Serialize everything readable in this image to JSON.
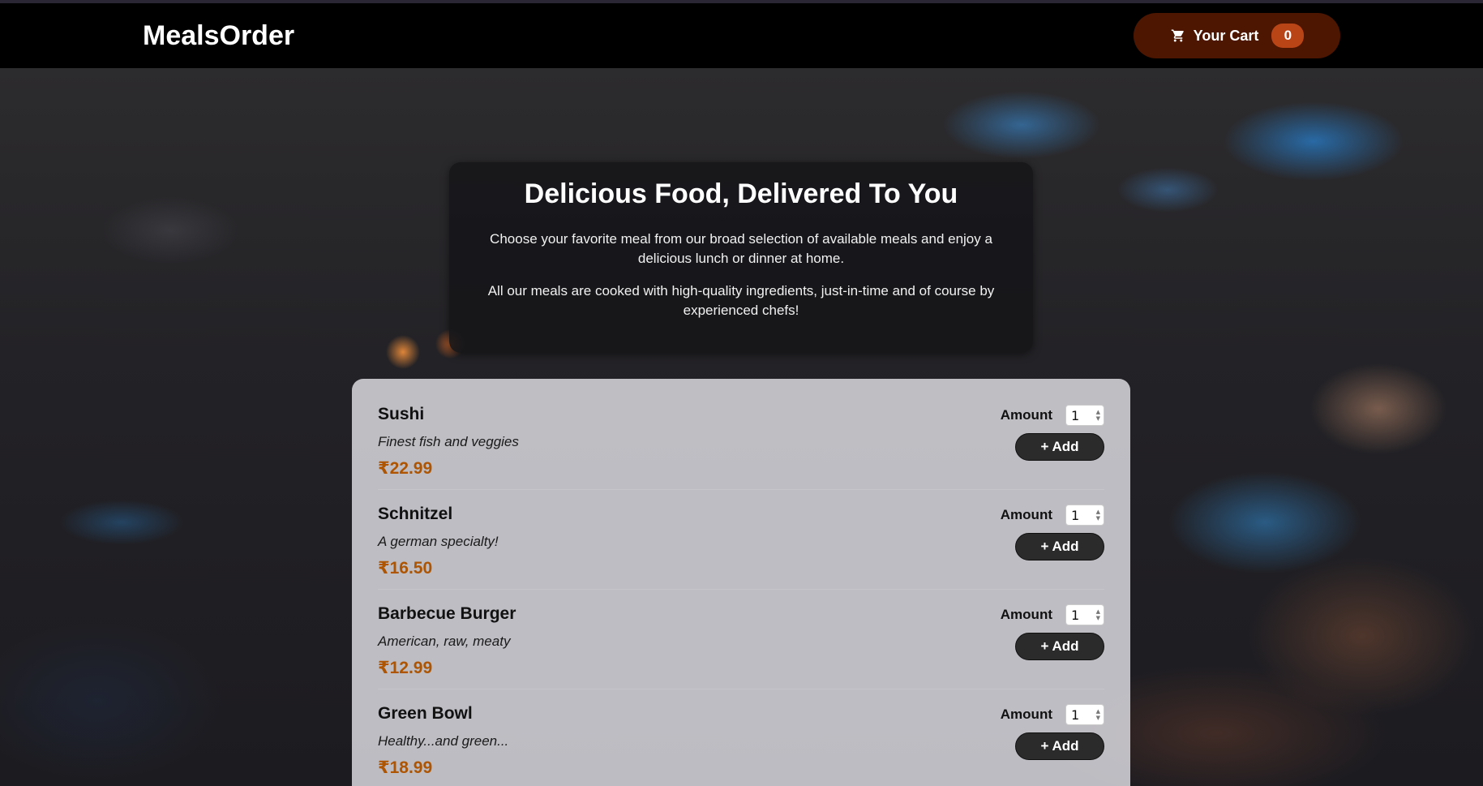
{
  "header": {
    "logo": "MealsOrder",
    "cart_label": "Your Cart",
    "cart_count": "0",
    "cart_icon": "shopping-cart-icon"
  },
  "summary": {
    "title": "Delicious Food, Delivered To You",
    "paragraph_1": "Choose your favorite meal from our broad selection of available meals and enjoy a delicious lunch or dinner at home.",
    "paragraph_2": "All our meals are cooked with high-quality ingredients, just-in-time and of course by experienced chefs!"
  },
  "meals": [
    {
      "name": "Sushi",
      "description": "Finest fish and veggies",
      "price": "₹22.99",
      "amount_label": "Amount",
      "amount_value": "1",
      "add_label": "+ Add"
    },
    {
      "name": "Schnitzel",
      "description": "A german specialty!",
      "price": "₹16.50",
      "amount_label": "Amount",
      "amount_value": "1",
      "add_label": "+ Add"
    },
    {
      "name": "Barbecue Burger",
      "description": "American, raw, meaty",
      "price": "₹12.99",
      "amount_label": "Amount",
      "amount_value": "1",
      "add_label": "+ Add"
    },
    {
      "name": "Green Bowl",
      "description": "Healthy...and green...",
      "price": "₹18.99",
      "amount_label": "Amount",
      "amount_value": "1",
      "add_label": "+ Add"
    }
  ],
  "colors": {
    "header_bg": "#000000",
    "cart_button_bg": "#4d1601",
    "cart_badge_bg": "#b94517",
    "price": "#ad5502"
  }
}
